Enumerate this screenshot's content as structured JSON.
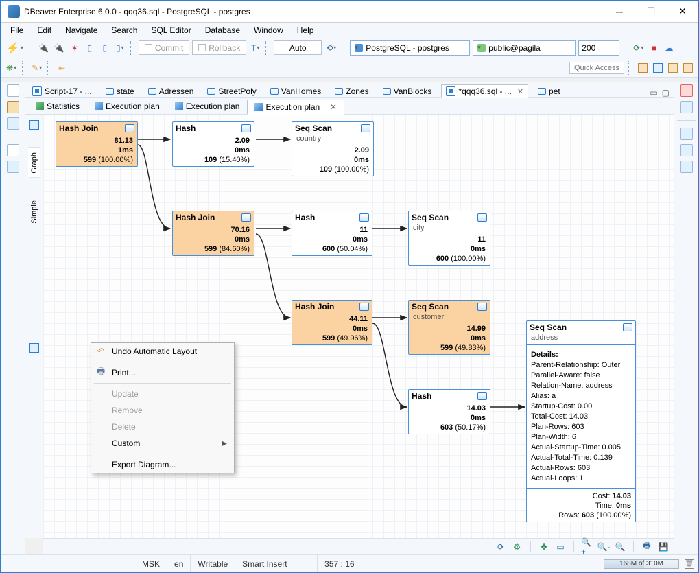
{
  "window": {
    "title": "DBeaver Enterprise 6.0.0 - qqq36.sql - PostgreSQL - postgres"
  },
  "menu": [
    "File",
    "Edit",
    "Navigate",
    "Search",
    "SQL Editor",
    "Database",
    "Window",
    "Help"
  ],
  "toolbar_top": {
    "commit": "Commit",
    "rollback": "Rollback",
    "auto": "Auto",
    "combo_conn": "PostgreSQL - postgres",
    "combo_schema": "public@pagila",
    "rows": "200",
    "quick_access_placeholder": "Quick Access"
  },
  "file_tabs": [
    {
      "label": "Script-17 - ...",
      "type": "sql"
    },
    {
      "label": "state",
      "type": "table"
    },
    {
      "label": "Adressen",
      "type": "table"
    },
    {
      "label": "StreetPoly",
      "type": "table"
    },
    {
      "label": "VanHomes",
      "type": "table"
    },
    {
      "label": "Zones",
      "type": "table"
    },
    {
      "label": "VanBlocks",
      "type": "table"
    },
    {
      "label": "*qqq36.sql - ...",
      "type": "sql",
      "active": true,
      "close": true
    },
    {
      "label": "pet",
      "type": "table"
    }
  ],
  "sub_tabs": [
    {
      "label": "Statistics",
      "icon": "g"
    },
    {
      "label": "Execution plan",
      "icon": "b"
    },
    {
      "label": "Execution plan",
      "icon": "b"
    },
    {
      "label": "Execution plan",
      "icon": "b",
      "active": true,
      "close": true
    }
  ],
  "vertical_tabs": {
    "graph": "Graph",
    "simple": "Simple"
  },
  "nodes": {
    "n0": {
      "title": "Hash Join",
      "cost": "81.13",
      "time": "1ms",
      "rows": "599",
      "pct": "(100.00%)"
    },
    "n1": {
      "title": "Hash",
      "cost": "2.09",
      "time": "0ms",
      "rows": "109",
      "pct": "(15.40%)"
    },
    "n2": {
      "title": "Seq Scan",
      "sub": "country",
      "cost": "2.09",
      "time": "0ms",
      "rows": "109",
      "pct": "(100.00%)"
    },
    "n3": {
      "title": "Hash Join",
      "cost": "70.16",
      "time": "0ms",
      "rows": "599",
      "pct": "(84.60%)"
    },
    "n4": {
      "title": "Hash",
      "cost": "11",
      "time": "0ms",
      "rows": "600",
      "pct": "(50.04%)"
    },
    "n5": {
      "title": "Seq Scan",
      "sub": "city",
      "cost": "11",
      "time": "0ms",
      "rows": "600",
      "pct": "(100.00%)"
    },
    "n6": {
      "title": "Hash Join",
      "cost": "44.11",
      "time": "0ms",
      "rows": "599",
      "pct": "(49.96%)"
    },
    "n7": {
      "title": "Seq Scan",
      "sub": "customer",
      "cost": "14.99",
      "time": "0ms",
      "rows": "599",
      "pct": "(49.83%)"
    },
    "n8": {
      "title": "Hash",
      "cost": "14.03",
      "time": "0ms",
      "rows": "603",
      "pct": "(50.17%)"
    },
    "n9": {
      "title": "Seq Scan",
      "sub": "address",
      "details_label": "Details:",
      "details": [
        "Parent-Relationship: Outer",
        "Parallel-Aware: false",
        "Relation-Name: address",
        "Alias: a",
        "Startup-Cost: 0.00",
        "Total-Cost: 14.03",
        "Plan-Rows: 603",
        "Plan-Width: 6",
        "Actual-Startup-Time: 0.005",
        "Actual-Total-Time: 0.139",
        "Actual-Rows: 603",
        "Actual-Loops: 1"
      ],
      "footer": {
        "costL": "Cost:",
        "cost": "14.03",
        "timeL": "Time:",
        "time": "0ms",
        "rowsL": "Rows:",
        "rows": "603",
        "pct": "(100.00%)"
      }
    }
  },
  "context_menu": {
    "undo": "Undo Automatic Layout",
    "print": "Print...",
    "update": "Update",
    "remove": "Remove",
    "delete": "Delete",
    "custom": "Custom",
    "export": "Export Diagram..."
  },
  "status": {
    "tz": "MSK",
    "lang": "en",
    "writable": "Writable",
    "insert": "Smart Insert",
    "pos": "357 : 16",
    "mem": "168M of 310M"
  }
}
